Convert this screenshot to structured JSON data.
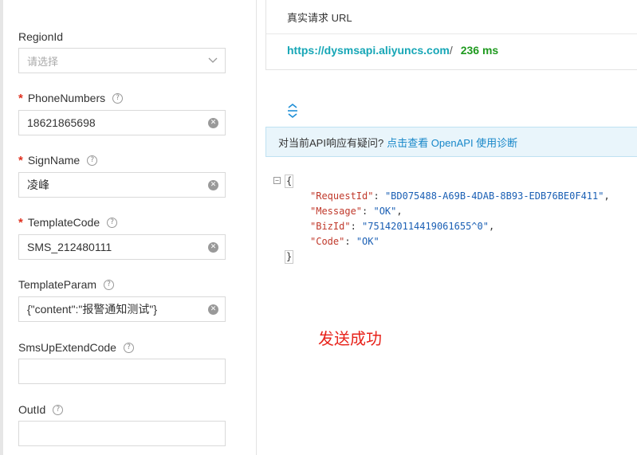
{
  "form": {
    "region": {
      "label": "RegionId",
      "placeholder": "请选择"
    },
    "phone": {
      "label": "PhoneNumbers",
      "value": "18621865698"
    },
    "sign": {
      "label": "SignName",
      "value": "凌峰"
    },
    "template_code": {
      "label": "TemplateCode",
      "value": "SMS_212480111"
    },
    "template_param": {
      "label": "TemplateParam",
      "value": "{\"content\":\"报警通知测试\"}"
    },
    "sms_up": {
      "label": "SmsUpExtendCode",
      "value": ""
    },
    "out_id": {
      "label": "OutId",
      "value": ""
    },
    "required_mark": "*",
    "help_glyph": "?"
  },
  "request": {
    "title": "真实请求 URL",
    "url": "https://dysmsapi.aliyuncs.com",
    "slash": "/",
    "latency": "236 ms"
  },
  "notice": {
    "text": "对当前API响应有疑问?",
    "link": "点击查看 OpenAPI 使用诊断"
  },
  "response": {
    "fold_glyph": "−",
    "open_brace": "{",
    "close_brace": "}",
    "lines": [
      {
        "key": "\"RequestId\"",
        "value": "\"BD075488-A69B-4DAB-8B93-EDB76BE0F411\"",
        "sep": ","
      },
      {
        "key": "\"Message\"",
        "value": "\"OK\"",
        "sep": ","
      },
      {
        "key": "\"BizId\"",
        "value": "\"751420114419061655^0\"",
        "sep": ","
      },
      {
        "key": "\"Code\"",
        "value": "\"OK\"",
        "sep": ""
      }
    ]
  },
  "annotation": "发送成功",
  "colors": {
    "link": "#16a6b6",
    "latency": "#1f9a1f",
    "required": "#e0301e",
    "annotation": "#e8231b"
  }
}
